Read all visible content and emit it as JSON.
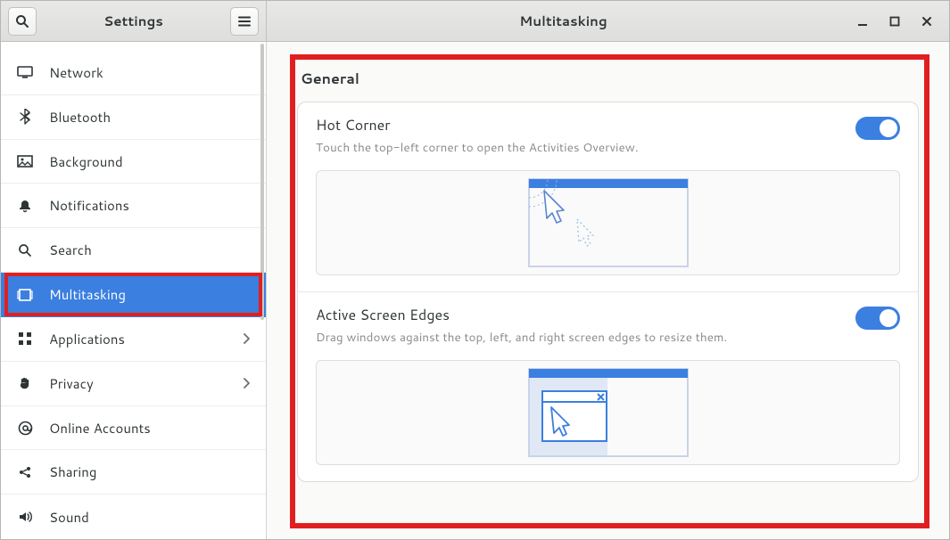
{
  "header": {
    "sidebar_title": "Settings",
    "page_title": "Multitasking"
  },
  "sidebar": {
    "items": [
      {
        "id": "network",
        "label": "Network",
        "icon": "display-icon",
        "selected": false,
        "has_more": false
      },
      {
        "id": "bluetooth",
        "label": "Bluetooth",
        "icon": "bluetooth-icon",
        "selected": false,
        "has_more": false
      },
      {
        "id": "background",
        "label": "Background",
        "icon": "background-icon",
        "selected": false,
        "has_more": false
      },
      {
        "id": "notifications",
        "label": "Notifications",
        "icon": "bell-icon",
        "selected": false,
        "has_more": false
      },
      {
        "id": "search",
        "label": "Search",
        "icon": "search-icon",
        "selected": false,
        "has_more": false
      },
      {
        "id": "multitasking",
        "label": "Multitasking",
        "icon": "multitask-icon",
        "selected": true,
        "has_more": false
      },
      {
        "id": "applications",
        "label": "Applications",
        "icon": "apps-icon",
        "selected": false,
        "has_more": true
      },
      {
        "id": "privacy",
        "label": "Privacy",
        "icon": "hand-icon",
        "selected": false,
        "has_more": true
      },
      {
        "id": "online",
        "label": "Online Accounts",
        "icon": "at-icon",
        "selected": false,
        "has_more": false
      },
      {
        "id": "sharing",
        "label": "Sharing",
        "icon": "share-icon",
        "selected": false,
        "has_more": false
      },
      {
        "id": "sound",
        "label": "Sound",
        "icon": "sound-icon",
        "selected": false,
        "has_more": false
      }
    ]
  },
  "content": {
    "section_title": "General",
    "rows": [
      {
        "title": "Hot Corner",
        "desc": "Touch the top-left corner to open the Activities Overview.",
        "switch_on": true
      },
      {
        "title": "Active Screen Edges",
        "desc": "Drag windows against the top, left, and right screen edges to resize them.",
        "switch_on": true
      }
    ]
  },
  "colors": {
    "accent": "#3b7fe0",
    "highlight": "#e02020"
  }
}
